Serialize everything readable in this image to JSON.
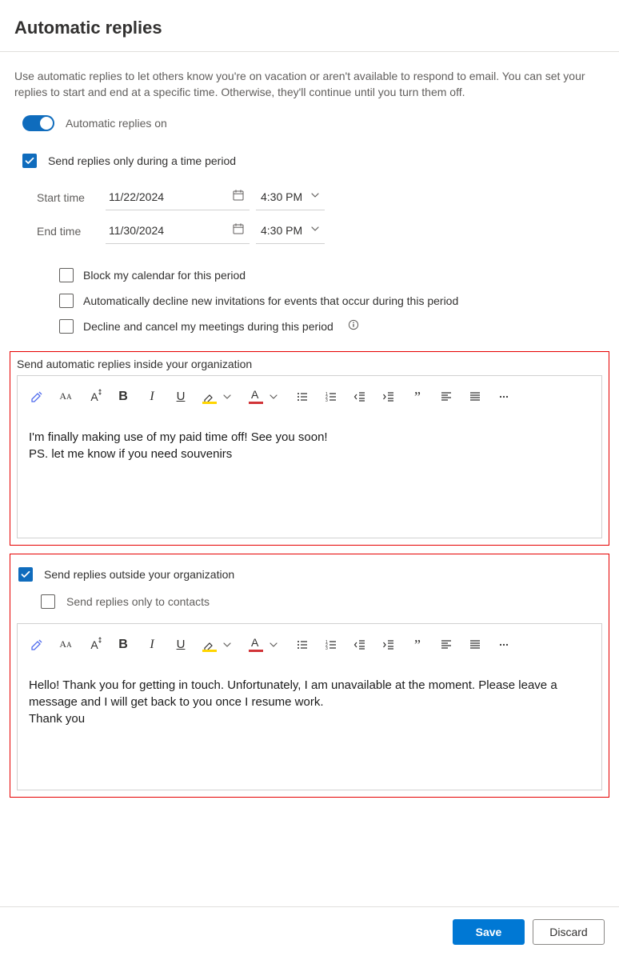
{
  "title": "Automatic replies",
  "description": "Use automatic replies to let others know you're on vacation or aren't available to respond to email. You can set your replies to start and end at a specific time. Otherwise, they'll continue until you turn them off.",
  "toggle": {
    "label": "Automatic replies on",
    "on": true
  },
  "send_during_period": {
    "label": "Send replies only during a time period",
    "checked": true
  },
  "start": {
    "label": "Start time",
    "date": "11/22/2024",
    "time": "4:30 PM"
  },
  "end": {
    "label": "End time",
    "date": "11/30/2024",
    "time": "4:30 PM"
  },
  "options": {
    "block_calendar": {
      "label": "Block my calendar for this period",
      "checked": false
    },
    "decline_new": {
      "label": "Automatically decline new invitations for events that occur during this period",
      "checked": false
    },
    "cancel_meetings": {
      "label": "Decline and cancel my meetings during this period",
      "checked": false
    }
  },
  "inside": {
    "section_label": "Send automatic replies inside your organization",
    "body": "I'm finally making use of my paid time off! See you soon!\nPS. let me know if you need souvenirs"
  },
  "outside": {
    "send_outside": {
      "label": "Send replies outside your organization",
      "checked": true
    },
    "only_contacts": {
      "label": "Send replies only to contacts",
      "checked": false
    },
    "body": "Hello! Thank you for getting in touch. Unfortunately, I am unavailable at the moment. Please leave a message and I will get back to you once I resume work.\nThank you"
  },
  "footer": {
    "save": "Save",
    "discard": "Discard"
  },
  "icons": {
    "tb": [
      "paint-format",
      "font-family",
      "font-size",
      "bold",
      "italic",
      "underline",
      "highlight",
      "font-color",
      "bulleted-list",
      "numbered-list",
      "outdent",
      "indent",
      "quote",
      "align-left",
      "align-justify",
      "more"
    ]
  },
  "colors": {
    "highlight_underline": "#ffd500",
    "fontcolor_underline": "#d13438"
  }
}
